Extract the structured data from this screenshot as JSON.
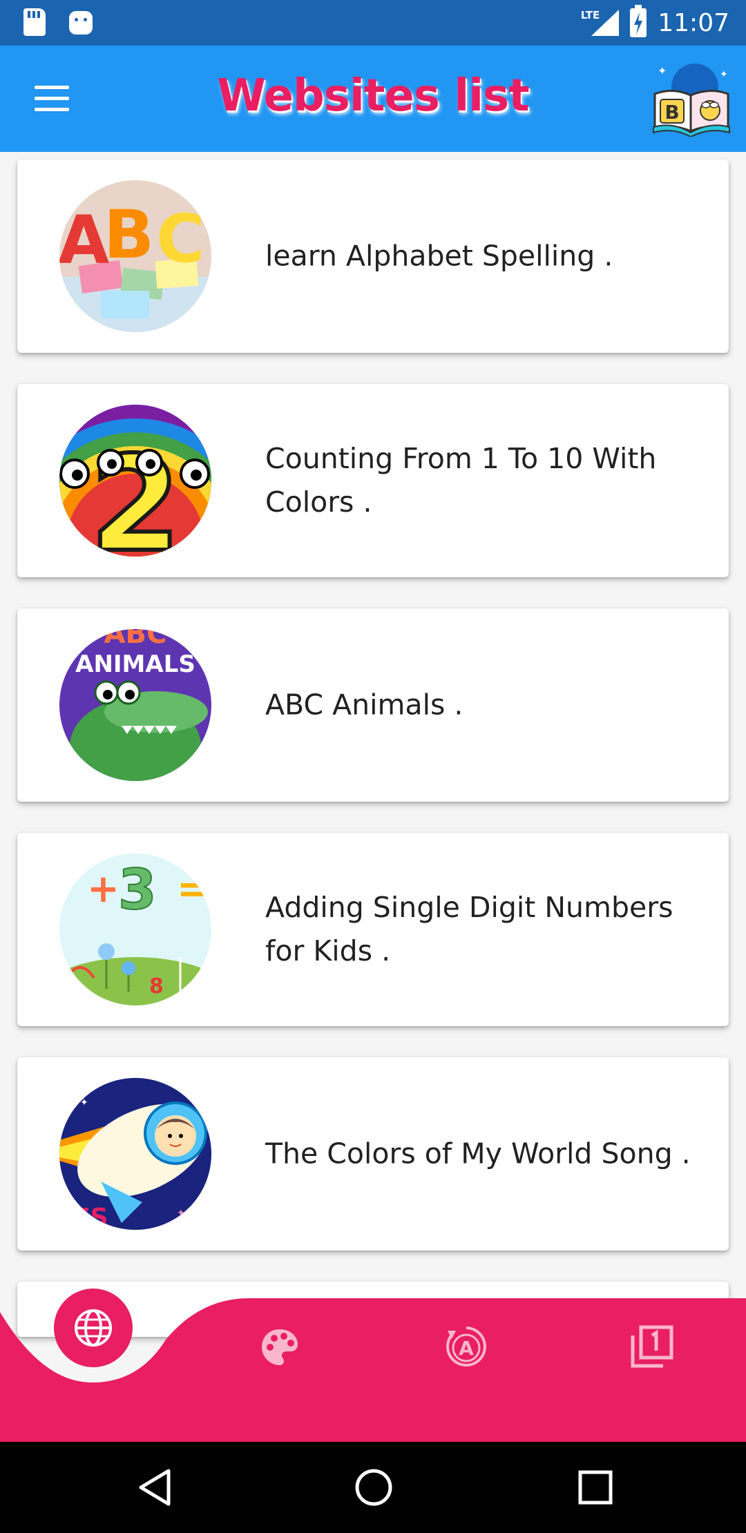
{
  "status_bar": {
    "network": "LTE",
    "time": "11:07"
  },
  "app_bar": {
    "title": "Websites list",
    "menu_icon": "hamburger-menu-icon",
    "logo_letter": "B"
  },
  "items": [
    {
      "title": "learn Alphabet Spelling .",
      "thumb_text": "ABC"
    },
    {
      "title": "Counting From 1 To 10 With Colors .",
      "thumb_text": "2"
    },
    {
      "title": "ABC Animals .",
      "thumb_text": "ANIMALS"
    },
    {
      "title": "Adding Single Digit Numbers for Kids .",
      "thumb_text": "+3"
    },
    {
      "title": "The Colors of My World Song .",
      "thumb_text": "ES"
    }
  ],
  "bottom_nav": {
    "items": [
      {
        "icon": "globe-icon",
        "selected": true
      },
      {
        "icon": "palette-icon",
        "selected": false
      },
      {
        "icon": "letter-a-icon",
        "selected": false
      },
      {
        "icon": "number-one-icon",
        "selected": false
      }
    ],
    "accent": "#e91e63"
  },
  "colors": {
    "status_bar": "#1a64b0",
    "app_bar": "#2196f3",
    "title": "#e91e63",
    "bottom_nav": "#e91e63"
  }
}
